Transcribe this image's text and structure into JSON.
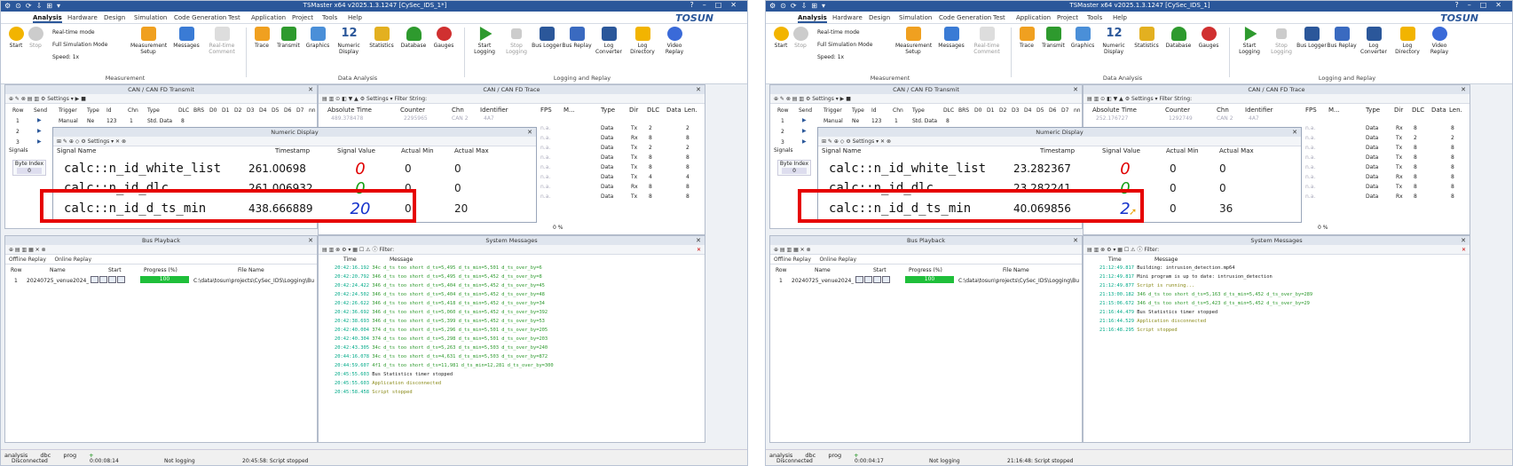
{
  "windows": [
    {
      "title": "TSMaster x64 v2025.1.3.1247 [CySec_IDS_1*]",
      "menu": [
        "Analysis",
        "Hardware",
        "Design",
        "Simulation",
        "Code Generation",
        "Test",
        "Application",
        "Project",
        "Tools",
        "Help"
      ],
      "brand": "TOSUN",
      "ribbon": {
        "start": "Start",
        "stop": "Stop",
        "realtime": "Real-time mode",
        "fullsim": "Full Simulation Mode",
        "speed": "Speed: 1x",
        "measurement_setup": "Measurement Setup",
        "messages": "Messages",
        "realtime_comment": "Real-time Comment",
        "trace": "Trace",
        "transmit": "Transmit",
        "graphics": "Graphics",
        "numeric_display": "Numeric Display",
        "statistics": "Statistics",
        "database": "Database",
        "gauges": "Gauges",
        "start_logging": "Start Logging",
        "stop_logging": "Stop Logging",
        "bus_logger": "Bus Logger",
        "bus_replay": "Bus Replay",
        "log_converter": "Log Converter",
        "log_directory": "Log Directory",
        "video_replay": "Video Replay",
        "group_measurement": "Measurement",
        "group_data_analysis": "Data Analysis",
        "group_logging": "Logging and Replay",
        "numeric_number": "12"
      },
      "transmit": {
        "title": "CAN / CAN FD Transmit",
        "headers": [
          "Row",
          "Send",
          "Trigger",
          "Type",
          "Id",
          "Chn",
          "Type",
          "DLC",
          "BRS",
          "D0",
          "D1",
          "D2",
          "D3",
          "D4",
          "D5",
          "D6",
          "D7",
          "nn"
        ],
        "row1": {
          "row": "1",
          "trigger": "Manual",
          "type": "Ne",
          "id": "123",
          "chn": "1",
          "ftype": "Std. Data",
          "dlc": "8"
        },
        "row2": "2",
        "row3": "3",
        "signals_label": "Signals",
        "byte_index_label": "Byte Index",
        "byte_index_value": "0"
      },
      "trace": {
        "title": "CAN / CAN FD Trace",
        "filter_label": "Filter String:",
        "headers": [
          "Absolute Time",
          "Counter",
          "Chn",
          "Identifier",
          "FPS",
          "M...",
          "Type",
          "Dir",
          "DLC",
          "Data",
          "Len."
        ],
        "first_row": {
          "time": "489.378478",
          "counter": "2295965",
          "chn": "CAN 2",
          "id": "4A7"
        },
        "rows": [
          {
            "fps": "n.a.",
            "type": "Data",
            "dir": "Tx",
            "dlc": "2",
            "len": "2"
          },
          {
            "fps": "n.a.",
            "type": "Data",
            "dir": "Rx",
            "dlc": "8",
            "len": "8"
          },
          {
            "fps": "n.a.",
            "type": "Data",
            "dir": "Tx",
            "dlc": "2",
            "len": "2"
          },
          {
            "fps": "n.a.",
            "type": "Data",
            "dir": "Tx",
            "dlc": "8",
            "len": "8"
          },
          {
            "fps": "n.a.",
            "type": "Data",
            "dir": "Tx",
            "dlc": "8",
            "len": "8"
          },
          {
            "fps": "n.a.",
            "type": "Data",
            "dir": "Tx",
            "dlc": "4",
            "len": "4"
          },
          {
            "fps": "n.a.",
            "type": "Data",
            "dir": "Rx",
            "dlc": "8",
            "len": "8"
          },
          {
            "fps": "n.a.",
            "type": "Data",
            "dir": "Tx",
            "dlc": "8",
            "len": "8"
          }
        ],
        "zoom": "0 %"
      },
      "numeric": {
        "title": "Numeric Display",
        "headers": [
          "Signal Name",
          "Timestamp",
          "Signal Value",
          "Actual Min",
          "Actual Max"
        ],
        "settings": "Settings",
        "rows": [
          {
            "name": "calc::n_id_white_list",
            "ts": "261.00698",
            "value": "0",
            "min": "0",
            "max": "0",
            "color": "#e00000"
          },
          {
            "name": "calc::n_id_dlc",
            "ts": "261.006932",
            "value": "0",
            "min": "0",
            "max": "0",
            "color": "#18a018"
          },
          {
            "name": "calc::n_id_d_ts_min",
            "ts": "438.666889",
            "value": "20",
            "min": "0",
            "max": "20",
            "color": "#1633cc"
          }
        ]
      },
      "playback": {
        "title": "Bus Playback",
        "offline": "Offline Replay",
        "online": "Online Replay",
        "headers": [
          "Row",
          "Name",
          "Start",
          "Progress (%)",
          "File Name"
        ],
        "row": {
          "row": "1",
          "name": "20240725_venue2024_I",
          "progress": "100",
          "file": "C:\\data\\tosun\\projects\\CySec_IDS\\Logging\\Bu"
        }
      },
      "system": {
        "title": "System Messages",
        "filter": "Filter:",
        "headers": [
          "Time",
          "Message"
        ],
        "messages": [
          {
            "t": "20:42:16.192",
            "m": "34c d_ts too short d_ts=5,495 d_ts_min=5,501 d_ts_over_by=6",
            "c": "green"
          },
          {
            "t": "20:42:20.792",
            "m": "346 d_ts too short d_ts=5,495 d_ts_min=5,452 d_ts_over_by=8",
            "c": "green"
          },
          {
            "t": "20:42:24.422",
            "m": "346 d_ts too short d_ts=5,404 d_ts_min=5,452 d_ts_over_by=45",
            "c": "green"
          },
          {
            "t": "20:42:24.502",
            "m": "346 d_ts too short d_ts=5,404 d_ts_min=5,452 d_ts_over_by=48",
            "c": "green"
          },
          {
            "t": "20:42:26.622",
            "m": "346 d_ts too short d_ts=5,418 d_ts_min=5,452 d_ts_over_by=34",
            "c": "green"
          },
          {
            "t": "20:42:36.692",
            "m": "346 d_ts too short d_ts=5,060 d_ts_min=5,452 d_ts_over_by=392",
            "c": "green"
          },
          {
            "t": "20:42:38.693",
            "m": "346 d_ts too short d_ts=5,399 d_ts_min=5,452 d_ts_over_by=53",
            "c": "green"
          },
          {
            "t": "20:42:40.004",
            "m": "374 d_ts too short d_ts=5,296 d_ts_min=5,501 d_ts_over_by=205",
            "c": "green"
          },
          {
            "t": "20:42:40.304",
            "m": "374 d_ts too short d_ts=5,298 d_ts_min=5,501 d_ts_over_by=203",
            "c": "green"
          },
          {
            "t": "20:42:43.305",
            "m": "34c d_ts too short d_ts=5,263 d_ts_min=5,503 d_ts_over_by=240",
            "c": "green"
          },
          {
            "t": "20:44:16.078",
            "m": "34c d_ts too short d_ts=4,631 d_ts_min=5,503 d_ts_over_by=872",
            "c": "green"
          },
          {
            "t": "20:44:59.607",
            "m": "4f1 d_ts too short d_ts=11,981 d_ts_min=12,281 d_ts_over_by=300",
            "c": "green"
          },
          {
            "t": "20:45:55.603",
            "m": "Bus Statistics timer stopped",
            "c": "dark"
          },
          {
            "t": "20:45:55.603",
            "m": "Application disconnected",
            "c": "olive"
          },
          {
            "t": "20:45:58.458",
            "m": "Script stopped",
            "c": "olive"
          }
        ]
      },
      "bottom_tabs": [
        "analysis",
        "dbc",
        "prog"
      ],
      "status": {
        "conn": "Disconnected",
        "time": "0:00:08:14",
        "logging": "Not logging",
        "script": "20:45:58: Script stopped"
      }
    },
    {
      "title": "TSMaster x64 v2025.1.3.1247 [CySec_IDS_1]",
      "menu": [
        "Analysis",
        "Hardware",
        "Design",
        "Simulation",
        "Code Generation",
        "Test",
        "Application",
        "Project",
        "Tools",
        "Help"
      ],
      "brand": "TOSUN",
      "ribbon": {
        "start": "Start",
        "stop": "Stop",
        "realtime": "Real-time mode",
        "fullsim": "Full Simulation Mode",
        "speed": "Speed: 1x",
        "measurement_setup": "Measurement Setup",
        "messages": "Messages",
        "realtime_comment": "Real-time Comment",
        "trace": "Trace",
        "transmit": "Transmit",
        "graphics": "Graphics",
        "numeric_display": "Numeric Display",
        "statistics": "Statistics",
        "database": "Database",
        "gauges": "Gauges",
        "start_logging": "Start Logging",
        "stop_logging": "Stop Logging",
        "bus_logger": "Bus Logger",
        "bus_replay": "Bus Replay",
        "log_converter": "Log Converter",
        "log_directory": "Log Directory",
        "video_replay": "Video Replay",
        "group_measurement": "Measurement",
        "group_data_analysis": "Data Analysis",
        "group_logging": "Logging and Replay",
        "numeric_number": "12"
      },
      "transmit": {
        "title": "CAN / CAN FD Transmit",
        "headers": [
          "Row",
          "Send",
          "Trigger",
          "Type",
          "Id",
          "Chn",
          "Type",
          "DLC",
          "BRS",
          "D0",
          "D1",
          "D2",
          "D3",
          "D4",
          "D5",
          "D6",
          "D7",
          "nn"
        ],
        "row1": {
          "row": "1",
          "trigger": "Manual",
          "type": "Ne",
          "id": "123",
          "chn": "1",
          "ftype": "Std. Data",
          "dlc": "8"
        },
        "row2": "2",
        "row3": "3",
        "signals_label": "Signals",
        "byte_index_label": "Byte Index",
        "byte_index_value": "0"
      },
      "trace": {
        "title": "CAN / CAN FD Trace",
        "filter_label": "Filter String:",
        "headers": [
          "Absolute Time",
          "Counter",
          "Chn",
          "Identifier",
          "FPS",
          "M...",
          "Type",
          "Dir",
          "DLC",
          "Data",
          "Len."
        ],
        "first_row": {
          "time": "252.176727",
          "counter": "1292749",
          "chn": "CAN 2",
          "id": "4A7"
        },
        "rows": [
          {
            "fps": "n.a.",
            "type": "Data",
            "dir": "Rx",
            "dlc": "8",
            "len": "8"
          },
          {
            "fps": "n.a.",
            "type": "Data",
            "dir": "Tx",
            "dlc": "2",
            "len": "2"
          },
          {
            "fps": "n.a.",
            "type": "Data",
            "dir": "Tx",
            "dlc": "8",
            "len": "8"
          },
          {
            "fps": "n.a.",
            "type": "Data",
            "dir": "Tx",
            "dlc": "8",
            "len": "8"
          },
          {
            "fps": "n.a.",
            "type": "Data",
            "dir": "Tx",
            "dlc": "8",
            "len": "8"
          },
          {
            "fps": "n.a.",
            "type": "Data",
            "dir": "Rx",
            "dlc": "8",
            "len": "8"
          },
          {
            "fps": "n.a.",
            "type": "Data",
            "dir": "Tx",
            "dlc": "8",
            "len": "8"
          },
          {
            "fps": "n.a.",
            "type": "Data",
            "dir": "Rx",
            "dlc": "8",
            "len": "8"
          }
        ],
        "zoom": "0 %"
      },
      "numeric": {
        "title": "Numeric Display",
        "headers": [
          "Signal Name",
          "Timestamp",
          "Signal Value",
          "Actual Min",
          "Actual Max"
        ],
        "settings": "Settings",
        "rows": [
          {
            "name": "calc::n_id_white_list",
            "ts": "23.282367",
            "value": "0",
            "min": "0",
            "max": "0",
            "color": "#e00000"
          },
          {
            "name": "calc::n_id_dlc",
            "ts": "23.282241",
            "value": "0",
            "min": "0",
            "max": "0",
            "color": "#18a018"
          },
          {
            "name": "calc::n_id_d_ts_min",
            "ts": "40.069856",
            "value": "2",
            "min": "0",
            "max": "36",
            "color": "#1633cc"
          }
        ]
      },
      "playback": {
        "title": "Bus Playback",
        "offline": "Offline Replay",
        "online": "Online Replay",
        "headers": [
          "Row",
          "Name",
          "Start",
          "Progress (%)",
          "File Name"
        ],
        "row": {
          "row": "1",
          "name": "20240725_venue2024_I",
          "progress": "100",
          "file": "C:\\data\\tosun\\projects\\CySec_IDS\\Logging\\Bu"
        }
      },
      "system": {
        "title": "System Messages",
        "filter": "Filter:",
        "headers": [
          "Time",
          "Message"
        ],
        "messages": [
          {
            "t": "21:12:49.817",
            "m": "Building: intrusion_detection.mp64",
            "c": "dark"
          },
          {
            "t": "21:12:49.817",
            "m": "Mini program is up to date: intrusion_detection",
            "c": "dark"
          },
          {
            "t": "21:12:49.877",
            "m": "Script is running...",
            "c": "olive"
          },
          {
            "t": "21:13:00.182",
            "m": "346 d_ts too short d_ts=5,163 d_ts_min=5,452 d_ts_over_by=289",
            "c": "green"
          },
          {
            "t": "21:15:06.672",
            "m": "346 d_ts too short d_ts=5,423 d_ts_min=5,452 d_ts_over_by=29",
            "c": "green"
          },
          {
            "t": "21:16:44.479",
            "m": "Bus Statistics timer stopped",
            "c": "dark"
          },
          {
            "t": "21:16:44.529",
            "m": "Application disconnected",
            "c": "olive"
          },
          {
            "t": "21:16:48.295",
            "m": "Script stopped",
            "c": "olive"
          }
        ]
      },
      "bottom_tabs": [
        "analysis",
        "dbc",
        "prog"
      ],
      "status": {
        "conn": "Disconnected",
        "time": "0:00:04:17",
        "logging": "Not logging",
        "script": "21:16:48: Script stopped"
      }
    }
  ],
  "colors": {
    "title_bar": "#2b579a",
    "highlight": "#e60000",
    "progress": "#1fbf3a"
  }
}
